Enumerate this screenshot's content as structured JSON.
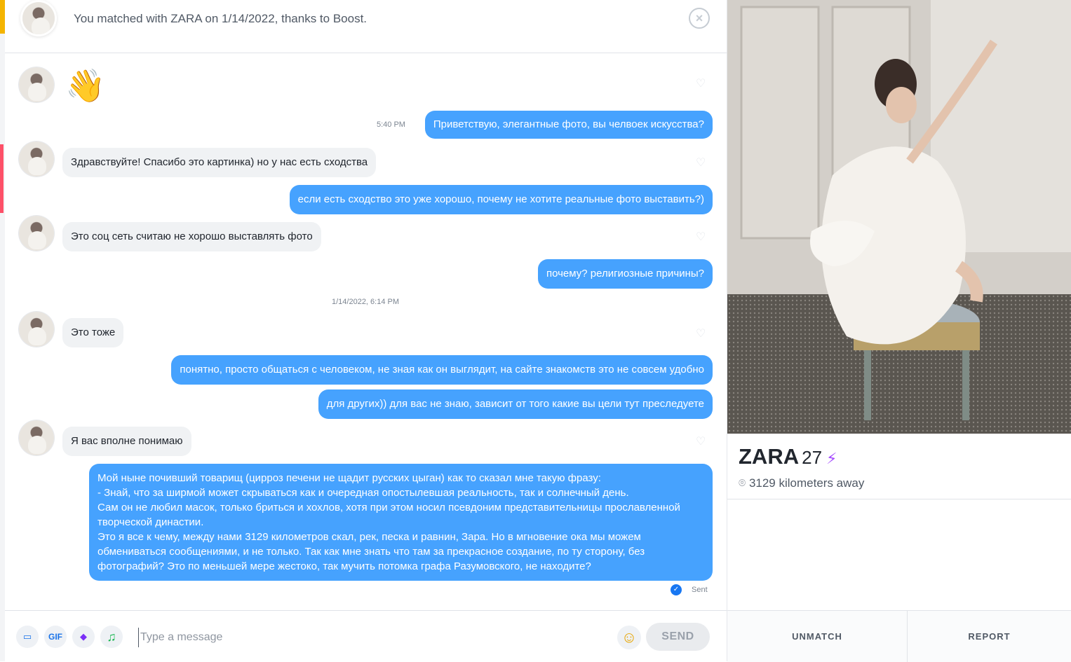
{
  "header": {
    "match_text": "You matched with ZARA on 1/14/2022, thanks to Boost."
  },
  "messages": [
    {
      "dir": "in",
      "text": "👋",
      "kind": "emoji"
    },
    {
      "dir": "out",
      "text": "Приветствую, элегантные фото, вы челвоек искусства?",
      "time": "5:40 PM"
    },
    {
      "dir": "in",
      "text": "Здравствуйте! Спасибо это картинка) но у нас есть сходства"
    },
    {
      "dir": "out",
      "text": "если есть сходство это уже хорошо, почему не хотите реальные фото выставить?)"
    },
    {
      "dir": "in",
      "text": "Это соц сеть считаю не хорошо выставлять фото"
    },
    {
      "dir": "out",
      "text": "почему? религиозные причины?"
    },
    {
      "dir": "in",
      "text": "Это тоже"
    },
    {
      "dir": "out",
      "text": "понятно, просто общаться с человеком, не зная как он выглядит, на сайте знакомств это не совсем удобно"
    },
    {
      "dir": "out",
      "text": "для других)) для вас не знаю, зависит от того какие вы цели тут преследуете"
    },
    {
      "dir": "in",
      "text": "Я вас вполне понимаю"
    },
    {
      "dir": "out",
      "kind": "long",
      "lines": [
        "Мой ныне почивший товарищ (цирроз печени не щадит русских цыган) как то сказал мне такую фразу:",
        "- Знай, что за ширмой может скрываться как и очередная опостылевшая реальность, так и солнечный день.",
        "Сам он не любил масок, только бриться и хохлов, хотя при этом носил псевдоним представительницы прославленной творческой династии.",
        "Это я все к чему, между нами 3129 километров скал, рек, песка и равнин, Зара. Но в мгновение ока мы можем обмениваться сообщениями, и не только. Так как мне знать что там за прекрасное создание, по ту сторону, без фотографий? Это по меньшей мере жестоко, так мучить потомка графа Разумовского, не находите?"
      ]
    }
  ],
  "timestamps": {
    "first": "5:40 PM",
    "divider": "1/14/2022, 6:14 PM"
  },
  "status": {
    "sent": "Sent"
  },
  "composer": {
    "placeholder": "Type a message",
    "gif_label": "GIF",
    "send_label": "SEND"
  },
  "profile": {
    "name": "ZARA",
    "age": "27",
    "distance": "3129 kilometers away",
    "boost_icon": "lightning-bolt-icon"
  },
  "actions": {
    "unmatch": "UNMATCH",
    "report": "REPORT"
  },
  "colors": {
    "outgoing_bubble": "#46a2fe",
    "incoming_bubble": "#f0f2f4",
    "boost_purple": "#a64dff",
    "match_banner_accent": "#f4b400",
    "red_indicator": "#fd5068"
  }
}
